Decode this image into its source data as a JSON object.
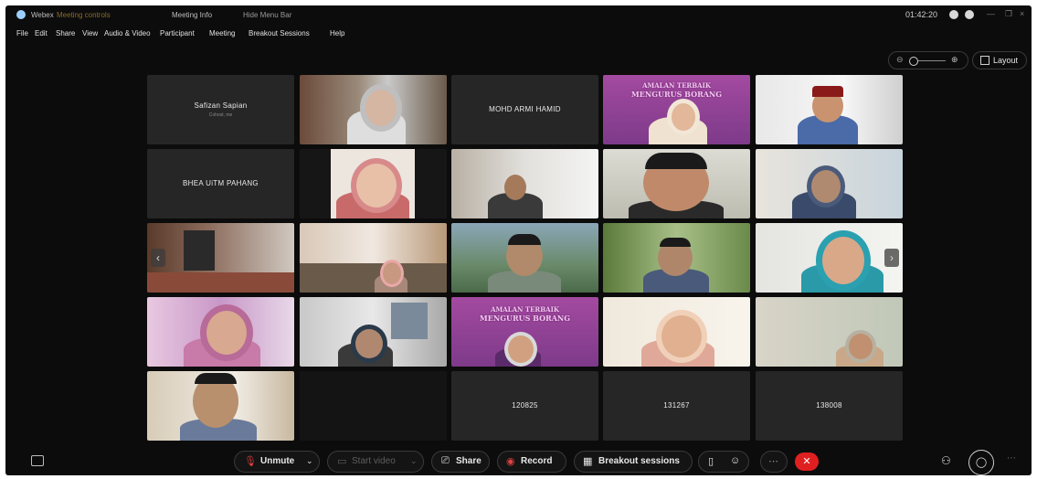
{
  "titlebar": {
    "app_name": "Webex",
    "app_sub": "Meeting controls",
    "meeting_info": "Meeting Info",
    "hide_menu": "Hide Menu Bar",
    "time": "01:42:20"
  },
  "menu": [
    "File",
    "Edit",
    "Share",
    "View",
    "Audio & Video",
    "Participant",
    "Meeting",
    "Breakout Sessions",
    "Help"
  ],
  "view": {
    "layout_label": "Layout"
  },
  "participants": {
    "p1_name": "Safizan Sapian",
    "p1_sub": "Cohost, me",
    "p3_name": "MOHD ARMI HAMID",
    "p6_name": "BHEA UiTM PAHANG",
    "p22_name": "120825",
    "p23_name": "131267",
    "p24_name": "138008"
  },
  "slide": {
    "line1": "AMALAN TERBAIK",
    "line2": "MENGURUS BORANG"
  },
  "controls": {
    "unmute": "Unmute",
    "start_video": "Start video",
    "share": "Share",
    "record": "Record",
    "breakout": "Breakout sessions"
  },
  "colors": {
    "end_call": "#e02020",
    "record_dot": "#e04040",
    "mute_icon": "#e04040"
  }
}
